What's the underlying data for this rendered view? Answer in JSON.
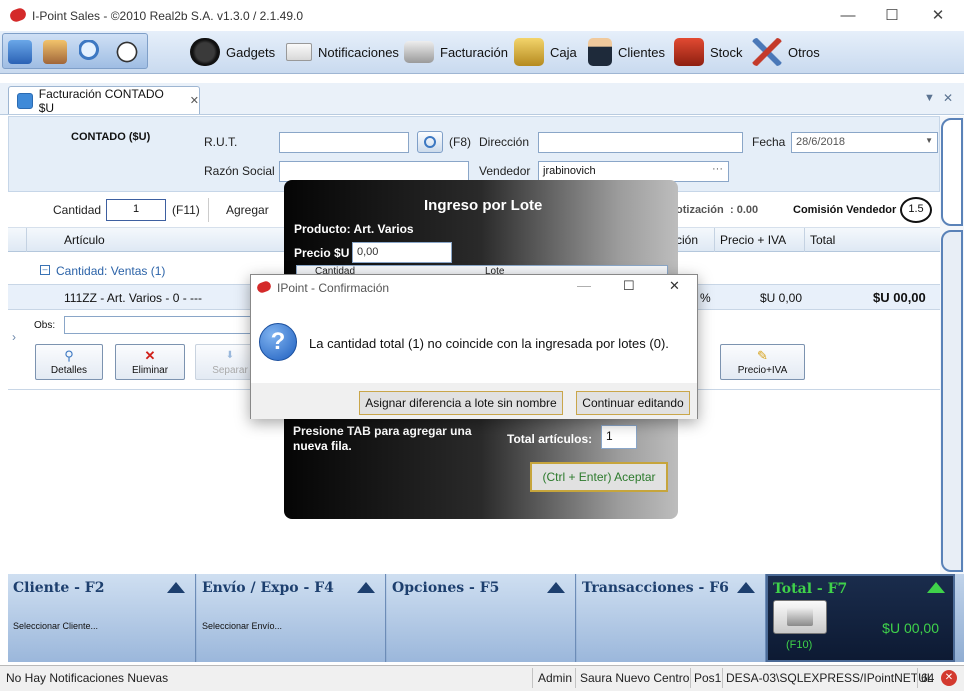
{
  "window": {
    "title": "I-Point Sales  - ©2010 Real2b S.A. v1.3.0 / 2.1.49.0",
    "minimize": "—",
    "maximize": "☐",
    "close": "✕"
  },
  "menu": {
    "quick": [
      "home-icon",
      "users-icon",
      "search-icon",
      "clock-icon"
    ],
    "items": [
      {
        "label": "Gadgets",
        "icon": "gauge-icon"
      },
      {
        "label": "Notificaciones",
        "icon": "envelope-icon"
      },
      {
        "label": "Facturación",
        "icon": "cash-register-icon"
      },
      {
        "label": "Caja",
        "icon": "safe-icon"
      },
      {
        "label": "Clientes",
        "icon": "client-icon"
      },
      {
        "label": "Stock",
        "icon": "boxes-icon"
      },
      {
        "label": "Otros",
        "icon": "tools-icon"
      }
    ]
  },
  "tab": {
    "label": "Facturación CONTADO $U",
    "close": "✕"
  },
  "tabstrip_controls": {
    "dropdown": "▼",
    "close": "✕"
  },
  "header": {
    "mode": "CONTADO ($U)",
    "rut_label": "R.U.T.",
    "rut_value": "",
    "f8": "(F8)",
    "direccion_label": "Dirección",
    "direccion_value": "",
    "fecha_label": "Fecha",
    "fecha_value": "28/6/2018",
    "razon_label": "Razón Social",
    "razon_value": "",
    "vendedor_label": "Vendedor",
    "vendedor_value": "jrabinovich",
    "vendedor_more": "···"
  },
  "entry": {
    "cantidad_label": "Cantidad",
    "cantidad_value": "1",
    "f11": "(F11)",
    "agregar_label": "Agregar",
    "cotizacion_label": "otización",
    "cotizacion_value": ":  0.00",
    "comision_label": "Comisión Vendedor",
    "comision_value": "1.5"
  },
  "grid": {
    "col_articulo": "Artículo",
    "col_bonificacion": "ción",
    "col_precio_iva": "Precio + IVA",
    "col_total": "Total",
    "group_toggle": "–",
    "group_label": "Cantidad: Ventas (1)",
    "row": {
      "articulo": "111ZZ - Art. Varios - 0 - ---",
      "bonif": "%",
      "precio": "$U 0,00",
      "total": "$U 00,00"
    },
    "obs_label": "Obs:",
    "buttons": [
      {
        "label": "Detalles",
        "icon": "search-icon"
      },
      {
        "label": "Eliminar",
        "icon": "delete-icon"
      },
      {
        "label": "Separar",
        "icon": "split-icon"
      },
      {
        "label": "Precio+IVA",
        "icon": "pencil-icon"
      }
    ],
    "row_pointer": "›"
  },
  "lote": {
    "title": "Ingreso por Lote",
    "producto": "Producto: Art. Varios",
    "precio_label": "Precio $U",
    "precio_value": "0,00",
    "col_cantidad": "Cantidad",
    "col_lote": "Lote",
    "hint": "Presione TAB para agregar una nueva fila.",
    "total_label": "Total artículos:",
    "total_value": "1",
    "accept": "(Ctrl + Enter) Aceptar"
  },
  "confirm": {
    "title": "IPoint - Confirmación",
    "message": "La cantidad total (1) no coincide con la ingresada por lotes (0).",
    "btn_assign": "Asignar diferencia a lote sin nombre",
    "btn_continue": "Continuar editando",
    "icon": "?"
  },
  "bottom": {
    "panels": [
      {
        "title": "Cliente - F2",
        "sub": "Seleccionar Cliente..."
      },
      {
        "title": "Envío / Expo - F4",
        "sub": "Seleccionar Envío..."
      },
      {
        "title": "Opciones - F5",
        "sub": ""
      },
      {
        "title": "Transacciones - F6",
        "sub": ""
      }
    ],
    "total": {
      "title": "Total - F7",
      "key": "(F10)",
      "amount": "$U 00,00"
    }
  },
  "status": {
    "notifications": "No Hay Notificaciones Nuevas",
    "user": "Admin",
    "branch": "Saura Nuevo Centro",
    "pos": "Pos1",
    "server": "DESA-03\\SQLEXPRESS/IPointNETUL",
    "bits": "64"
  },
  "colors": {
    "accent": "#1d3f6e",
    "total_green": "#3fd24a",
    "selection": "#e8f0fa"
  }
}
